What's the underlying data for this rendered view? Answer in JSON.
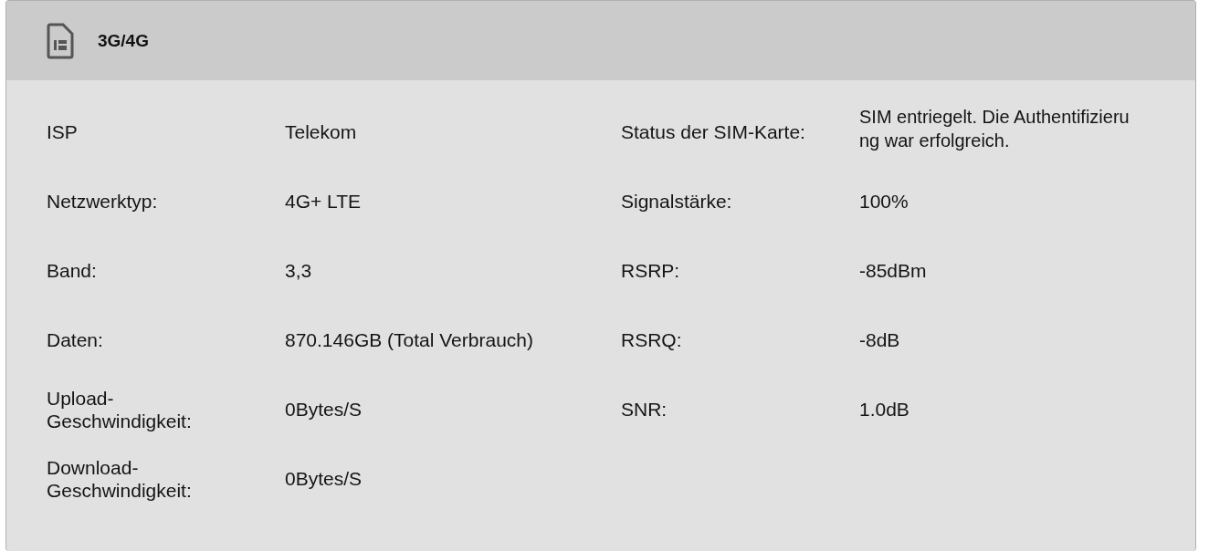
{
  "panel": {
    "title": "3G/4G"
  },
  "rows": [
    {
      "left": {
        "label": "ISP",
        "value": "Telekom"
      },
      "right": {
        "label": "Status der SIM-Karte:",
        "value": "SIM entriegelt. Die Authentifizierung war erfolgreich."
      }
    },
    {
      "left": {
        "label": "Netzwerktyp:",
        "value": "4G+ LTE"
      },
      "right": {
        "label": "Signalstärke:",
        "value": "100%"
      }
    },
    {
      "left": {
        "label": "Band:",
        "value": "3,3"
      },
      "right": {
        "label": "RSRP:",
        "value": "-85dBm"
      }
    },
    {
      "left": {
        "label": "Daten:",
        "value": "870.146GB (Total Verbrauch)"
      },
      "right": {
        "label": "RSRQ:",
        "value": "-8dB"
      }
    },
    {
      "left": {
        "label": "Upload-Geschwindigkeit:",
        "value": "0Bytes/S"
      },
      "right": {
        "label": "SNR:",
        "value": "1.0dB"
      }
    },
    {
      "left": {
        "label": "Download-Geschwindigkeit:",
        "value": "0Bytes/S"
      }
    }
  ]
}
